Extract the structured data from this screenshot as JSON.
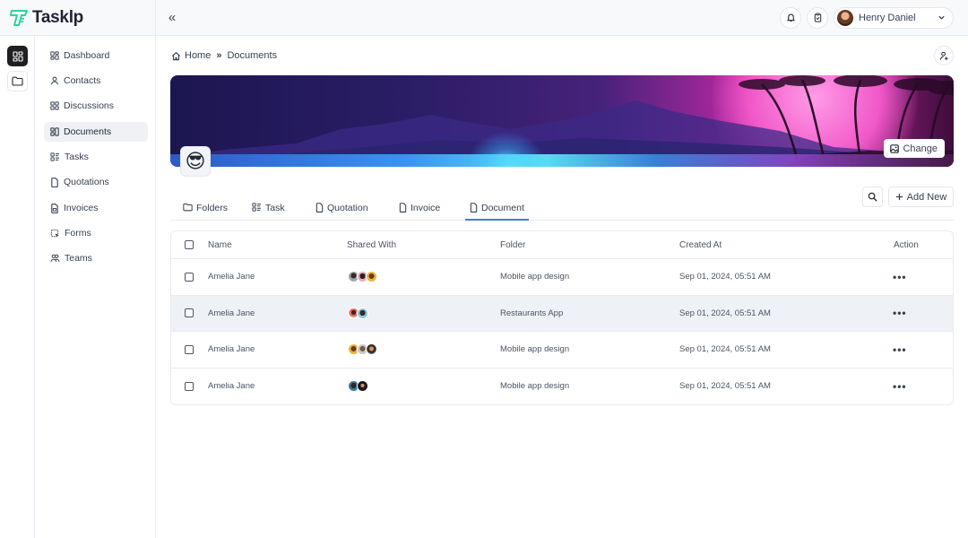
{
  "brand": {
    "name": "Tasklp",
    "accent": "#2bd4a4"
  },
  "header": {
    "collapse_icon": "«",
    "user": {
      "name": "Henry Daniel"
    }
  },
  "sidebar": {
    "items": [
      {
        "label": "Dashboard",
        "icon": "dashboard-icon"
      },
      {
        "label": "Contacts",
        "icon": "user-icon"
      },
      {
        "label": "Discussions",
        "icon": "discussions-icon"
      },
      {
        "label": "Documents",
        "icon": "documents-icon",
        "active": true
      },
      {
        "label": "Tasks",
        "icon": "tasks-icon"
      },
      {
        "label": "Quotations",
        "icon": "file-icon"
      },
      {
        "label": "Invoices",
        "icon": "invoice-icon"
      },
      {
        "label": "Forms",
        "icon": "forms-icon"
      },
      {
        "label": "Teams",
        "icon": "teams-icon"
      }
    ]
  },
  "breadcrumb": {
    "home": "Home",
    "separator": "»",
    "current": "Documents"
  },
  "banner": {
    "change_label": "Change",
    "emoji": "😎"
  },
  "tabs": [
    {
      "label": "Folders"
    },
    {
      "label": "Task"
    },
    {
      "label": "Quotation"
    },
    {
      "label": "Invoice"
    },
    {
      "label": "Document",
      "active": true
    }
  ],
  "toolbar": {
    "add_new_label": "Add New"
  },
  "table": {
    "columns": [
      "Name",
      "Shared With",
      "Folder",
      "Created At",
      "Action"
    ],
    "rows": [
      {
        "name": "Amelia Jane",
        "shared_count": 3,
        "folder": "Mobile app design",
        "created_at": "Sep 01, 2024, 05:51 AM",
        "action": "•••"
      },
      {
        "name": "Amelia Jane",
        "shared_count": 2,
        "folder": "Restaurants App",
        "created_at": "Sep 01, 2024, 05:51 AM",
        "action": "•••"
      },
      {
        "name": "Amelia Jane",
        "shared_count": 3,
        "folder": "Mobile app design",
        "created_at": "Sep 01, 2024, 05:51 AM",
        "action": "•••"
      },
      {
        "name": "Amelia Jane",
        "shared_count": 2,
        "folder": "Mobile app design",
        "created_at": "Sep 01, 2024, 05:51 AM",
        "action": "•••"
      }
    ]
  },
  "colors": {
    "tab_active": "#4d79d6",
    "row_highlight": "#eef1f6",
    "rail_active": "#1f1f22"
  }
}
